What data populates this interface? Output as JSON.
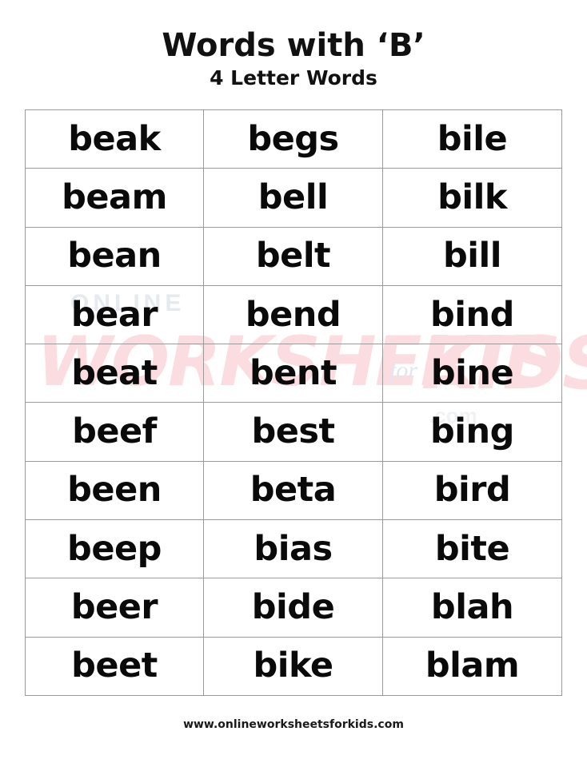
{
  "header": {
    "title": "Words with ‘B’",
    "subtitle": "4 Letter Words"
  },
  "watermark": {
    "line_online": "ONLINE",
    "line_main": "WORKSHEETS",
    "line_for": "for",
    "line_kids": "KIDS",
    "line_dotcom": ".com",
    "pink_color": "#fbdde1",
    "gray_color": "#e6eaf0"
  },
  "table": {
    "columns": 3,
    "rows": 10,
    "border_color": "#9a9a9a",
    "words": [
      [
        "beak",
        "begs",
        "bile"
      ],
      [
        "beam",
        "bell",
        "bilk"
      ],
      [
        "bean",
        "belt",
        "bill"
      ],
      [
        "bear",
        "bend",
        "bind"
      ],
      [
        "beat",
        "bent",
        "bine"
      ],
      [
        "beef",
        "best",
        "bing"
      ],
      [
        "been",
        "beta",
        "bird"
      ],
      [
        "beep",
        "bias",
        "bite"
      ],
      [
        "beer",
        "bide",
        "blah"
      ],
      [
        "beet",
        "bike",
        "blam"
      ]
    ]
  },
  "footer": {
    "url": "www.onlineworksheetsforkids.com"
  }
}
